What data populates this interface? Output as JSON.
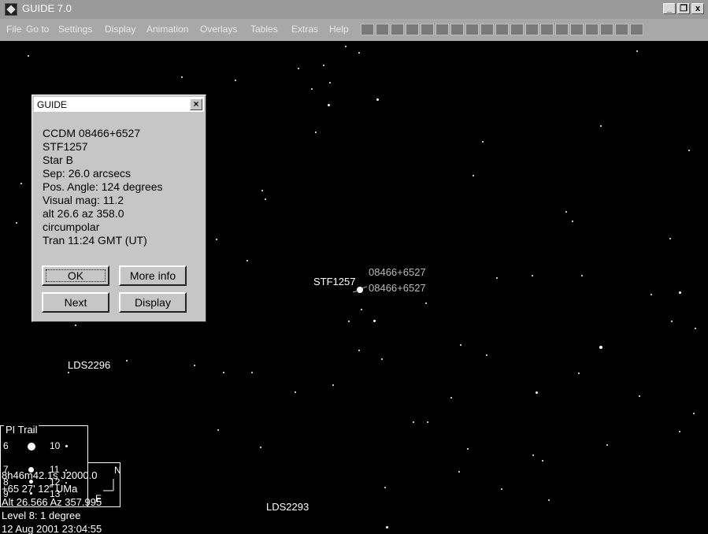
{
  "window": {
    "title": "GUIDE 7.0",
    "minimize": "_",
    "maximize": "❐",
    "close": "x"
  },
  "menu": [
    "File",
    "Go to",
    "Settings",
    "Display",
    "Animation",
    "Overlays",
    "Tables",
    "Extras",
    "Help"
  ],
  "dialog": {
    "title": "GUIDE",
    "close_label": "×",
    "lines": [
      "CCDM 08466+6527",
      "STF1257",
      "Star B",
      "Sep: 26.0 arcsecs",
      "Pos. Angle: 124 degrees",
      "Visual mag: 11.2",
      "alt 26.6  az  358.0",
      "circumpolar",
      "Tran 11:24 GMT (UT)"
    ],
    "buttons": {
      "ok": "OK",
      "more_info": "More info",
      "next": "Next",
      "display": "Display"
    }
  },
  "sky_labels": {
    "stf1257": "STF1257",
    "ccdm_a": "08466+6527",
    "ccdm_b": "08466+6527",
    "lds2296": "LDS2296",
    "lds2293": "LDS2293"
  },
  "legend": {
    "title": "PI Trail",
    "mags": [
      "6",
      "7",
      "8",
      "9",
      "10",
      "11",
      "12",
      "13"
    ],
    "compass_n": "N",
    "compass_e": "E"
  },
  "status": {
    "ra": "8h46m42.1s  J2000.0",
    "dec": "+65 27' 12\"    UMa",
    "altaz": "Alt 26.566  Az 357.995",
    "level": "Level 8: 1 degree",
    "datetime": "12 Aug 2001 23:04:55"
  }
}
